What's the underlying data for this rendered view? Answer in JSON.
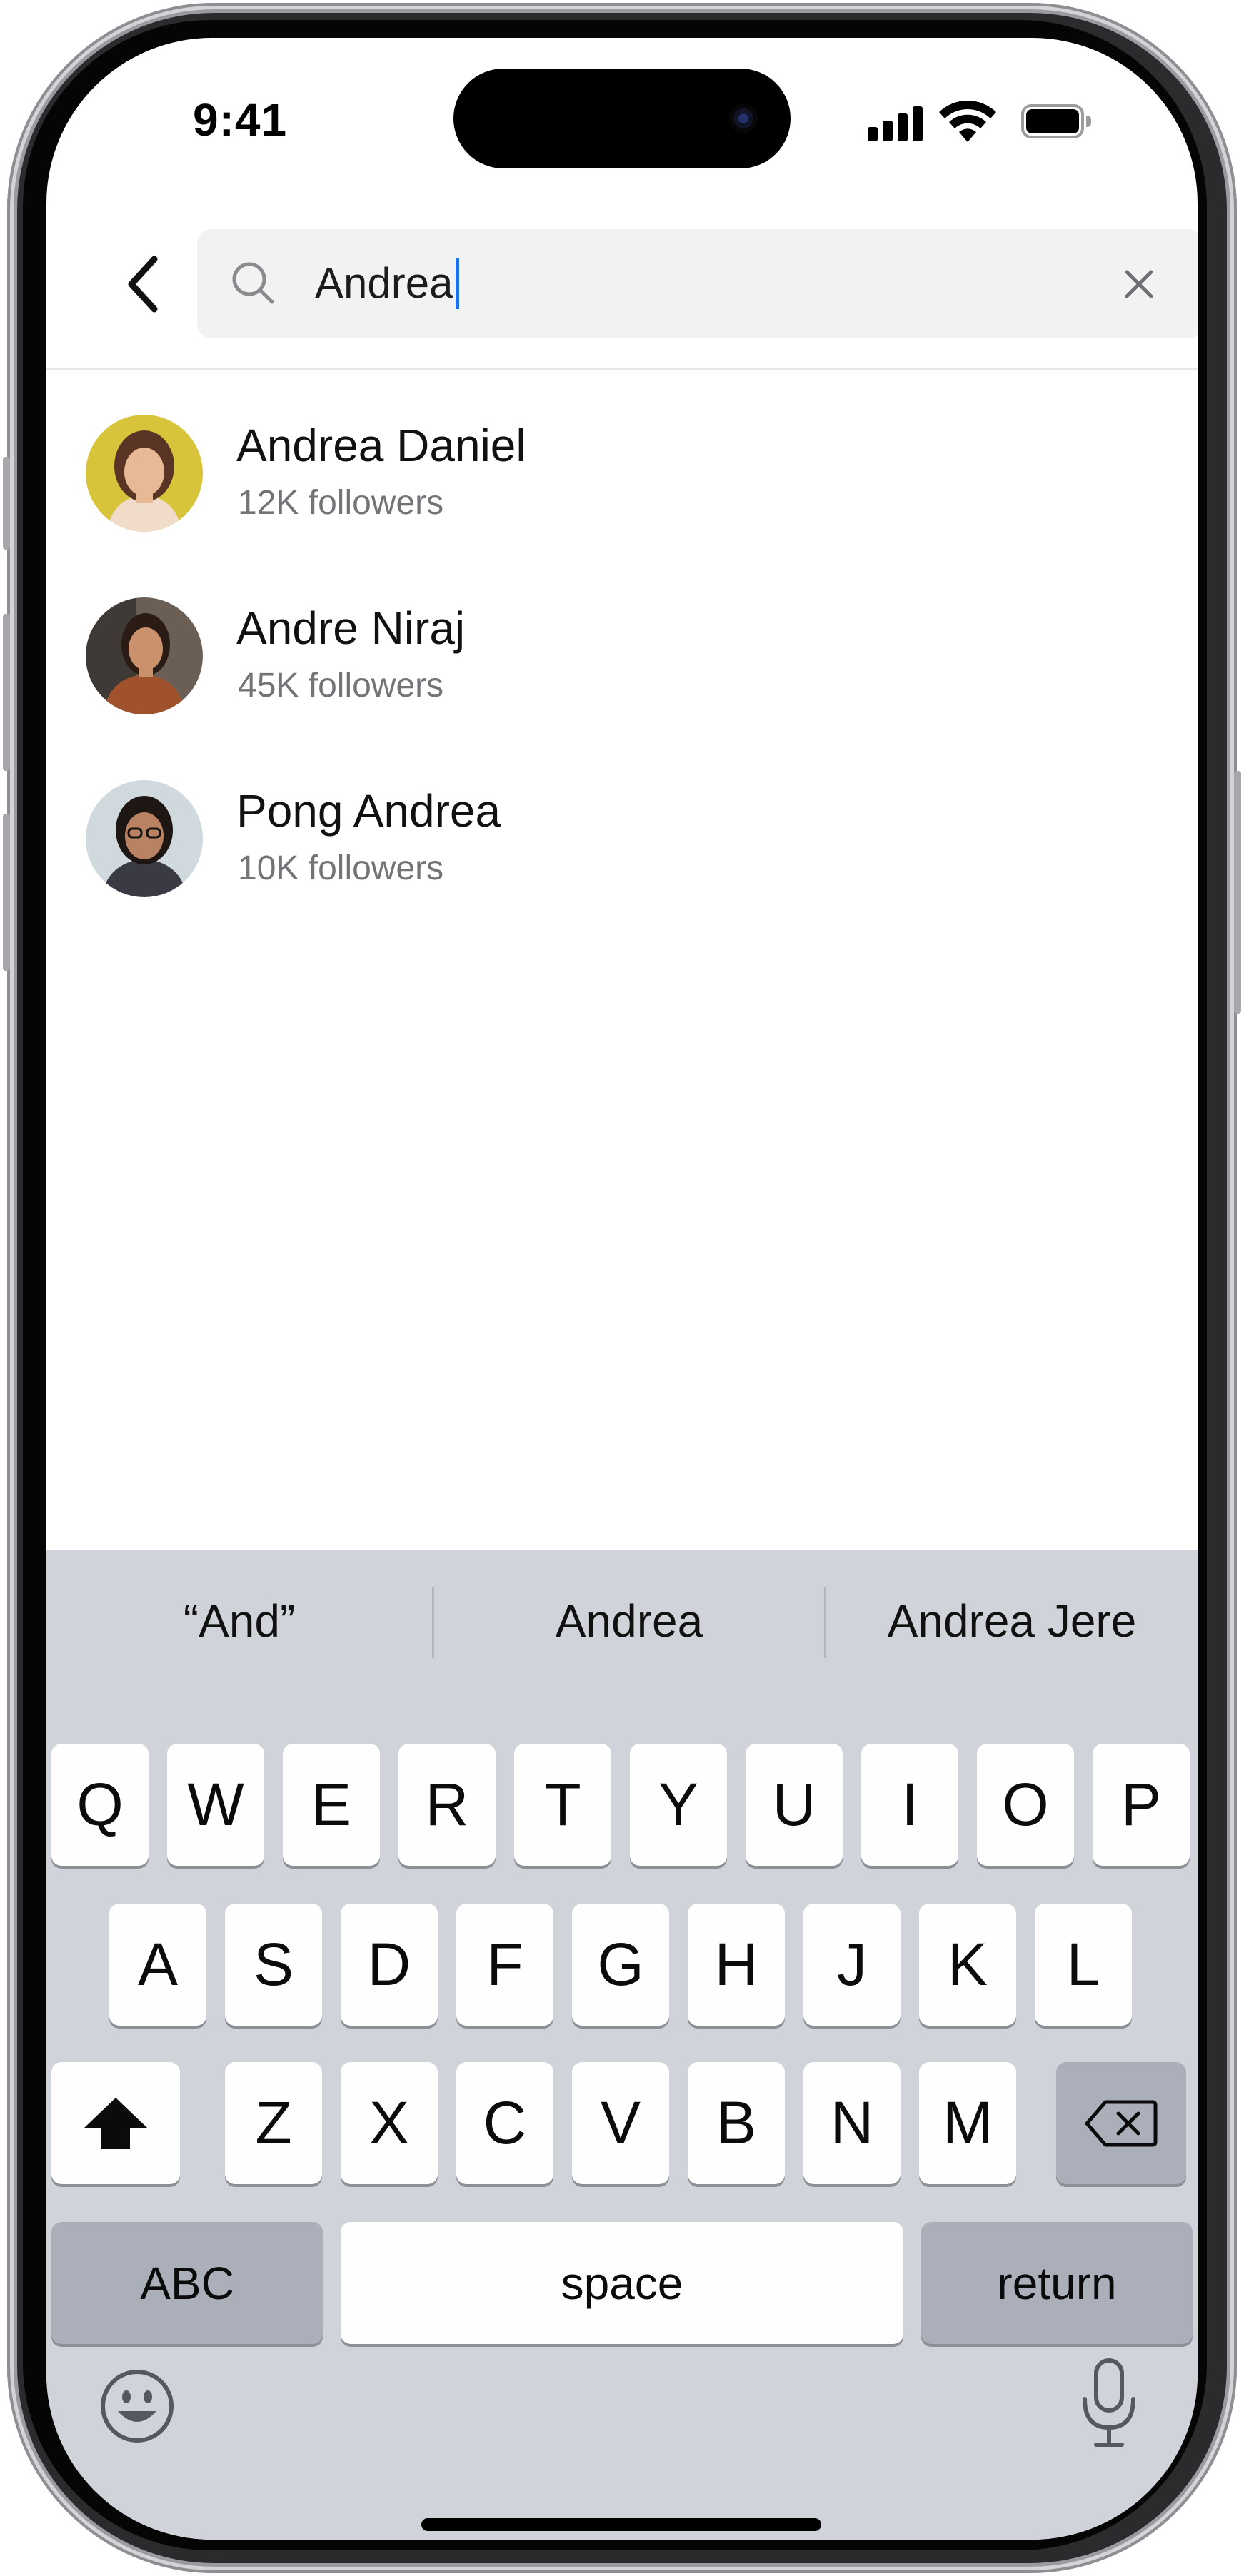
{
  "status_bar": {
    "time": "9:41"
  },
  "search": {
    "query": "Andrea"
  },
  "results": [
    {
      "name": "Andrea Daniel",
      "followers": "12K followers"
    },
    {
      "name": "Andre Niraj",
      "followers": "45K followers"
    },
    {
      "name": "Pong Andrea",
      "followers": "10K followers"
    }
  ],
  "keyboard": {
    "suggestions": [
      "“And”",
      "Andrea",
      "Andrea Jere"
    ],
    "row1": [
      "Q",
      "W",
      "E",
      "R",
      "T",
      "Y",
      "U",
      "I",
      "O",
      "P"
    ],
    "row2": [
      "A",
      "S",
      "D",
      "F",
      "G",
      "H",
      "J",
      "K",
      "L"
    ],
    "row3": [
      "Z",
      "X",
      "C",
      "V",
      "B",
      "N",
      "M"
    ],
    "abc_label": "ABC",
    "space_label": "space",
    "return_label": "return"
  },
  "colors": {
    "accent_cursor": "#1f6fe5",
    "keyboard_bg": "#d0d3d9"
  }
}
